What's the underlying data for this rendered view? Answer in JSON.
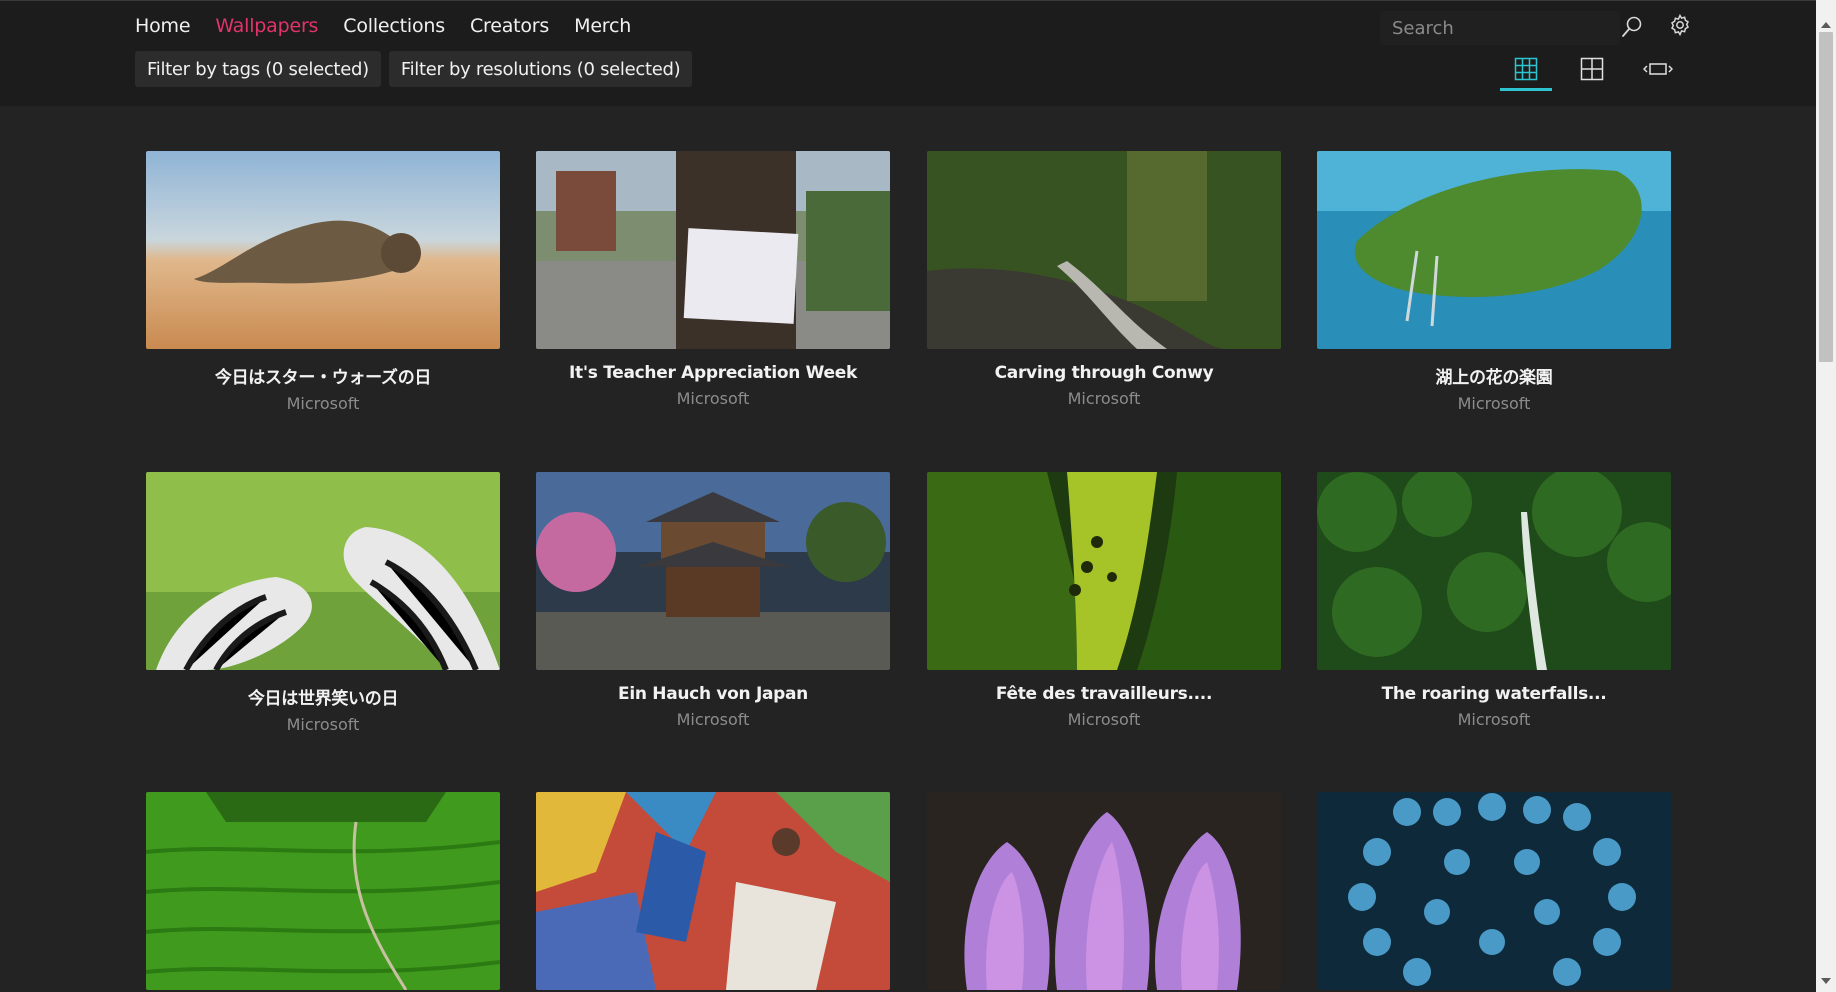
{
  "nav": {
    "items": [
      {
        "label": "Home",
        "active": false
      },
      {
        "label": "Wallpapers",
        "active": true
      },
      {
        "label": "Collections",
        "active": false
      },
      {
        "label": "Creators",
        "active": false
      },
      {
        "label": "Merch",
        "active": false
      }
    ]
  },
  "filters": {
    "tags_label": "Filter by tags (0 selected)",
    "resolutions_label": "Filter by resolutions (0 selected)"
  },
  "search": {
    "placeholder": "Search",
    "value": ""
  },
  "icons": {
    "search": "search-icon",
    "settings": "gear-icon",
    "grid_small": "small-grid-icon",
    "grid_large": "large-grid-icon",
    "fit": "fit-width-icon"
  },
  "colors": {
    "accent_active_nav": "#e2336b",
    "view_selected_underline": "#2ec4cf",
    "background": "#232323",
    "header": "#1c1c1c"
  },
  "wallpapers": [
    {
      "title": "今日はスター・ウォーズの日",
      "author": "Microsoft"
    },
    {
      "title": "It's Teacher Appreciation Week",
      "author": "Microsoft"
    },
    {
      "title": "Carving through Conwy",
      "author": "Microsoft"
    },
    {
      "title": "湖上の花の楽園",
      "author": "Microsoft"
    },
    {
      "title": "今日は世界笑いの日",
      "author": "Microsoft"
    },
    {
      "title": "Ein Hauch von Japan",
      "author": "Microsoft"
    },
    {
      "title": "Fête des travailleurs....",
      "author": "Microsoft"
    },
    {
      "title": "The roaring waterfalls...",
      "author": "Microsoft"
    },
    {
      "title": "",
      "author": ""
    },
    {
      "title": "",
      "author": ""
    },
    {
      "title": "",
      "author": ""
    },
    {
      "title": "",
      "author": ""
    }
  ]
}
